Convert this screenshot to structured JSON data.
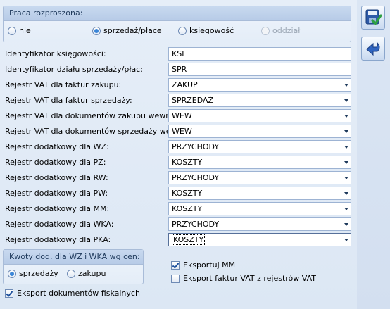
{
  "group_praca": {
    "title": "Praca rozproszona:",
    "options": [
      {
        "label": "nie",
        "selected": false,
        "enabled": true
      },
      {
        "label": "sprzedaż/płace",
        "selected": true,
        "enabled": true
      },
      {
        "label": "księgowość",
        "selected": false,
        "enabled": true
      },
      {
        "label": "oddział",
        "selected": false,
        "enabled": false
      }
    ]
  },
  "fields": [
    {
      "label": "Identyfikator księgowości:",
      "value": "KSI",
      "dropdown": false
    },
    {
      "label": "Identyfikator działu sprzedaży/płac:",
      "value": "SPR",
      "dropdown": false
    },
    {
      "label": "Rejestr VAT dla faktur zakupu:",
      "value": "ZAKUP",
      "dropdown": true
    },
    {
      "label": "Rejestr VAT dla faktur sprzedaży:",
      "value": "SPRZEDAŻ",
      "dropdown": true
    },
    {
      "label": "Rejestr VAT dla dokumentów zakupu wewn.:",
      "value": "WEW",
      "dropdown": true
    },
    {
      "label": "Rejestr VAT dla dokumentów sprzedaży wewn.:",
      "value": "WEW",
      "dropdown": true
    },
    {
      "label": "Rejestr dodatkowy dla WZ:",
      "value": "PRZYCHODY",
      "dropdown": true
    },
    {
      "label": "Rejestr dodatkowy dla PZ:",
      "value": "KOSZTY",
      "dropdown": true
    },
    {
      "label": "Rejestr dodatkowy dla RW:",
      "value": "PRZYCHODY",
      "dropdown": true
    },
    {
      "label": "Rejestr dodatkowy dla PW:",
      "value": "KOSZTY",
      "dropdown": true
    },
    {
      "label": "Rejestr dodatkowy dla MM:",
      "value": "KOSZTY",
      "dropdown": true
    },
    {
      "label": "Rejestr dodatkowy dla WKA:",
      "value": "PRZYCHODY",
      "dropdown": true
    },
    {
      "label": "Rejestr dodatkowy dla PKA:",
      "value": "KOSZTY",
      "dropdown": true
    }
  ],
  "group_kwoty": {
    "title": "Kwoty dod. dla WZ i WKA wg cen:",
    "options": [
      {
        "label": "sprzedaży",
        "selected": true
      },
      {
        "label": "zakupu",
        "selected": false
      }
    ]
  },
  "checkboxes": {
    "eksportuj_mm": {
      "label": "Eksportuj MM",
      "checked": true
    },
    "eksport_faktur": {
      "label": "Eksport faktur VAT z rejestrów VAT",
      "checked": false
    },
    "eksport_fiskalnych": {
      "label": "Eksport dokumentów fiskalnych",
      "checked": true
    }
  },
  "toolbar": {
    "save_icon": "save-check-icon",
    "undo_icon": "undo-arrow-icon"
  }
}
